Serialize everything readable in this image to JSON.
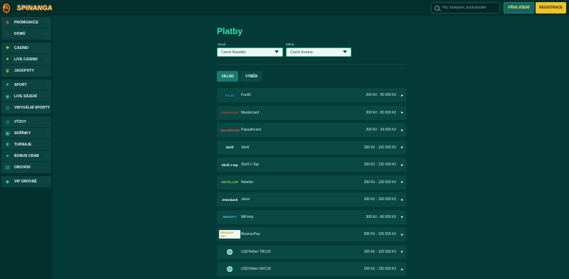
{
  "header": {
    "logo_text": "SPINANGA",
    "emblem_text": "EL",
    "search_placeholder": "Hry, kategorie, poskytovatel",
    "login_label": "PŘIHLÁŠENÍ",
    "register_label": "REGISTRACE"
  },
  "sidebar": {
    "groups": [
      [
        {
          "label": "PROMOAKCE",
          "icon": "gift-icon"
        },
        {
          "label": "DOMŮ",
          "icon": "home-icon"
        }
      ],
      [
        {
          "label": "CASINO",
          "icon": "casino-icon"
        },
        {
          "label": "LIVE CASINO",
          "icon": "cards-icon"
        },
        {
          "label": "JACKPOTY",
          "icon": "crown-icon"
        }
      ],
      [
        {
          "label": "SPORT",
          "icon": "ball-icon"
        },
        {
          "label": "LIVE SÁZENÍ",
          "icon": "live-icon"
        },
        {
          "label": "VIRTUÁLNÍ SPORTY",
          "icon": "virtual-icon"
        }
      ],
      [
        {
          "label": "VÝZVY",
          "icon": "target-icon"
        },
        {
          "label": "SKŘÍNKY",
          "icon": "locker-icon"
        },
        {
          "label": "TURNAJE",
          "icon": "trophy-icon"
        },
        {
          "label": "BONUS CRAB",
          "icon": "crab-icon"
        },
        {
          "label": "OBCHOD",
          "icon": "shop-icon"
        }
      ],
      [
        {
          "label": "VIP ÚROVNĚ",
          "icon": "diamond-icon"
        }
      ]
    ]
  },
  "page": {
    "title": "Platby",
    "country_label": "Země",
    "country_value": "Czech Republic",
    "currency_label": "Měna",
    "currency_value": "Czech Koruna",
    "tab_deposit": "VKLAD",
    "tab_withdraw": "VÝBĚR"
  },
  "payments": [
    {
      "logo": "FunID",
      "name": "FunID",
      "range": "200 Kč - 50 000 Kč"
    },
    {
      "logo": "mastercard",
      "name": "Mastercard",
      "range": "200 Kč - 50 000 Kč"
    },
    {
      "logo": "paysafecard",
      "name": "Paysafecard",
      "range": "200 Kč - 24 000 Kč"
    },
    {
      "logo": "Skrill",
      "name": "Skrill",
      "range": "200 Kč - 120 000 Kč"
    },
    {
      "logo": "Skrill 1-tap",
      "name": "Skrill 1-Tap",
      "range": "200 Kč - 120 000 Kč"
    },
    {
      "logo": "NETELLER",
      "name": "Neteller",
      "range": "200 Kč - 120 000 Kč"
    },
    {
      "logo": "Jetonbank",
      "name": "Jeton",
      "range": "200 Kč - 100 000 Kč"
    },
    {
      "logo": "MIFINITY",
      "name": "MiFinity",
      "range": "300 Kč - 60 000 Kč"
    },
    {
      "logo": "BINANCE PAY",
      "name": "BinancePay",
      "range": "505 Kč - 125 555 Kč"
    },
    {
      "logo": "",
      "name": "USDTether TRC20",
      "range": "255 Kč - 125 555 Kč"
    },
    {
      "logo": "",
      "name": "USDTether ERC20",
      "range": "255 Kč - 125 555 Kč"
    }
  ]
}
